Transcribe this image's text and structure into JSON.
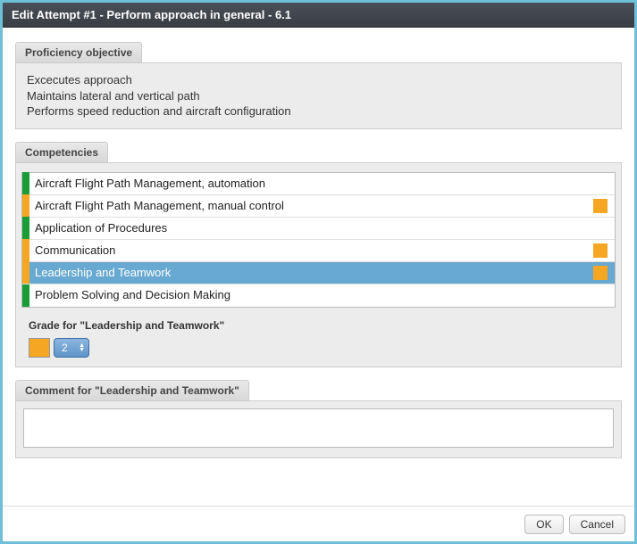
{
  "window": {
    "title": "Edit Attempt #1 - Perform approach in general - 6.1"
  },
  "colors": {
    "green": "#1a9c36",
    "orange": "#f5a623",
    "selected": "#68a9d1"
  },
  "proficiency": {
    "label": "Proficiency objective",
    "lines": [
      "Excecutes approach",
      "Maintains lateral and vertical path",
      "Performs speed reduction and aircraft configuration"
    ]
  },
  "competencies": {
    "label": "Competencies",
    "items": [
      {
        "name": "Aircraft Flight Path Management, automation",
        "bar": "green",
        "badge": false,
        "selected": false
      },
      {
        "name": "Aircraft Flight Path Management, manual control",
        "bar": "orange",
        "badge": true,
        "selected": false
      },
      {
        "name": "Application of Procedures",
        "bar": "green",
        "badge": false,
        "selected": false
      },
      {
        "name": "Communication",
        "bar": "orange",
        "badge": true,
        "selected": false
      },
      {
        "name": "Leadership and Teamwork",
        "bar": "orange",
        "badge": true,
        "selected": true
      },
      {
        "name": "Problem Solving and Decision Making",
        "bar": "green",
        "badge": false,
        "selected": false
      }
    ],
    "grade": {
      "label": "Grade for \"Leadership and Teamwork\"",
      "swatch_color": "#f5a623",
      "value": "2"
    }
  },
  "comment": {
    "label": "Comment for \"Leadership and Teamwork\"",
    "value": ""
  },
  "footer": {
    "ok": "OK",
    "cancel": "Cancel"
  }
}
